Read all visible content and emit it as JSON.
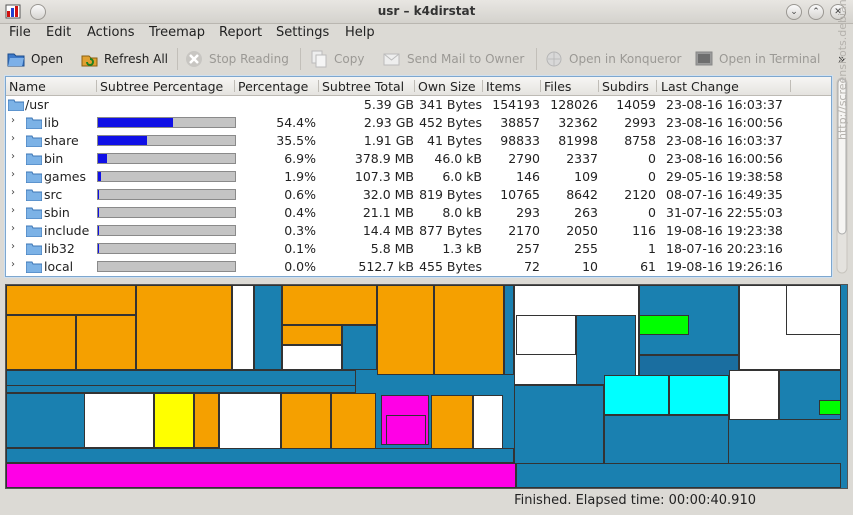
{
  "window": {
    "title": "usr – k4dirstat"
  },
  "menu": [
    "File",
    "Edit",
    "Actions",
    "Treemap",
    "Report",
    "Settings",
    "Help"
  ],
  "toolbar": {
    "open": "Open",
    "refresh_all": "Refresh All",
    "stop_reading": "Stop Reading",
    "copy": "Copy",
    "send_mail": "Send Mail to Owner",
    "open_konqueror": "Open in Konqueror",
    "open_terminal": "Open in Terminal",
    "more": "»"
  },
  "columns": [
    "Name",
    "Subtree Percentage",
    "Percentage",
    "Subtree Total",
    "Own Size",
    "Items",
    "Files",
    "Subdirs",
    "Last Change"
  ],
  "root": {
    "name": "/usr",
    "subtree_total": "5.39 GB",
    "own_size": "341 Bytes",
    "items": "154193",
    "files": "128026",
    "subdirs": "14059",
    "last_change": "23-08-16  16:03:37"
  },
  "rows": [
    {
      "name": "lib",
      "subtree_pct": 54.4,
      "percentage": "54.4%",
      "subtree_total": "2.93 GB",
      "own_size": "452 Bytes",
      "items": "38857",
      "files": "32362",
      "subdirs": "2993",
      "last_change": "23-08-16  16:00:56"
    },
    {
      "name": "share",
      "subtree_pct": 35.5,
      "percentage": "35.5%",
      "subtree_total": "1.91 GB",
      "own_size": "41 Bytes",
      "items": "98833",
      "files": "81998",
      "subdirs": "8758",
      "last_change": "23-08-16  16:03:37"
    },
    {
      "name": "bin",
      "subtree_pct": 6.9,
      "percentage": "6.9%",
      "subtree_total": "378.9 MB",
      "own_size": "46.0 kB",
      "items": "2790",
      "files": "2337",
      "subdirs": "0",
      "last_change": "23-08-16  16:00:56"
    },
    {
      "name": "games",
      "subtree_pct": 1.9,
      "percentage": "1.9%",
      "subtree_total": "107.3 MB",
      "own_size": "6.0 kB",
      "items": "146",
      "files": "109",
      "subdirs": "0",
      "last_change": "29-05-16  19:38:58"
    },
    {
      "name": "src",
      "subtree_pct": 0.6,
      "percentage": "0.6%",
      "subtree_total": "32.0 MB",
      "own_size": "819 Bytes",
      "items": "10765",
      "files": "8642",
      "subdirs": "2120",
      "last_change": "08-07-16  16:49:35"
    },
    {
      "name": "sbin",
      "subtree_pct": 0.4,
      "percentage": "0.4%",
      "subtree_total": "21.1 MB",
      "own_size": "8.0 kB",
      "items": "293",
      "files": "263",
      "subdirs": "0",
      "last_change": "31-07-16  22:55:03"
    },
    {
      "name": "include",
      "subtree_pct": 0.3,
      "percentage": "0.3%",
      "subtree_total": "14.4 MB",
      "own_size": "877 Bytes",
      "items": "2170",
      "files": "2050",
      "subdirs": "116",
      "last_change": "19-08-16  19:23:38"
    },
    {
      "name": "lib32",
      "subtree_pct": 0.1,
      "percentage": "0.1%",
      "subtree_total": "5.8 MB",
      "own_size": "1.3 kB",
      "items": "257",
      "files": "255",
      "subdirs": "1",
      "last_change": "18-07-16  20:23:16"
    },
    {
      "name": "local",
      "subtree_pct": 0.0,
      "percentage": "0.0%",
      "subtree_total": "512.7 kB",
      "own_size": "455 Bytes",
      "items": "72",
      "files": "10",
      "subdirs": "61",
      "last_change": "19-08-16  19:26:16"
    }
  ],
  "status": "Finished. Elapsed time: 00:00:40.910",
  "watermark": "http://screenshots.debian.net",
  "colors": {
    "bar_fill": "#1010e6",
    "treemap_blue": "#1a80b0",
    "treemap_orange": "#f5a000",
    "treemap_magenta": "#ff00e6",
    "treemap_yellow": "#ffff00",
    "treemap_cyan": "#00ffff",
    "treemap_green": "#00ff00"
  }
}
